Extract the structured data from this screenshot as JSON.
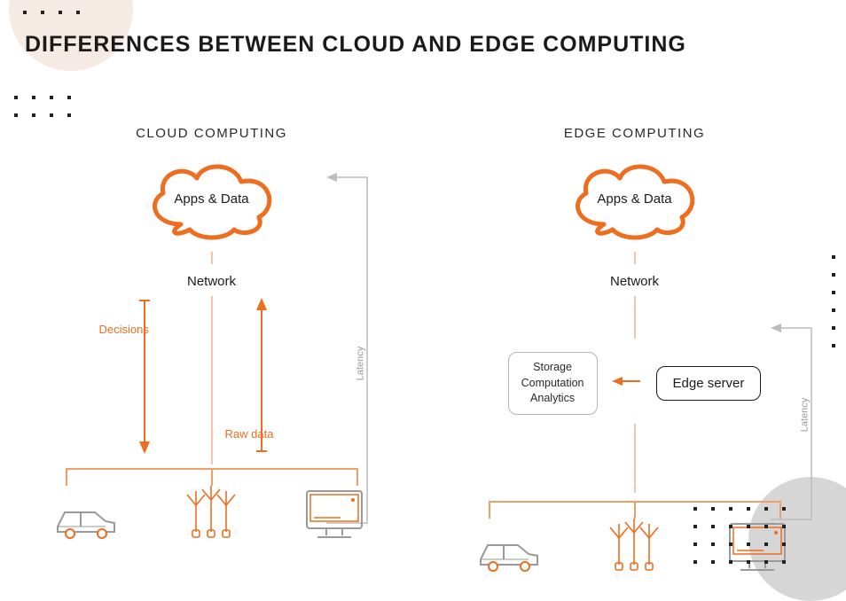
{
  "title": "DIFFERENCES BETWEEN CLOUD AND EDGE COMPUTING",
  "colors": {
    "accent": "#ee6d1e",
    "accent_light": "#f09e68",
    "muted": "#aaaaaa"
  },
  "cloud_panel": {
    "title": "CLOUD COMPUTING",
    "cloud_label": "Apps & Data",
    "network_label": "Network",
    "down_arrow_label": "Decisions",
    "up_arrow_label": "Raw data",
    "latency_label": "Latency",
    "devices": [
      "car-icon",
      "wind-turbine-icon",
      "monitor-icon"
    ]
  },
  "edge_panel": {
    "title": "EDGE COMPUTING",
    "cloud_label": "Apps & Data",
    "network_label": "Network",
    "edge_server_label": "Edge server",
    "side_box_lines": [
      "Storage",
      "Computation",
      "Analytics"
    ],
    "latency_label": "Latency",
    "devices": [
      "car-icon",
      "wind-turbine-icon",
      "monitor-icon"
    ]
  }
}
